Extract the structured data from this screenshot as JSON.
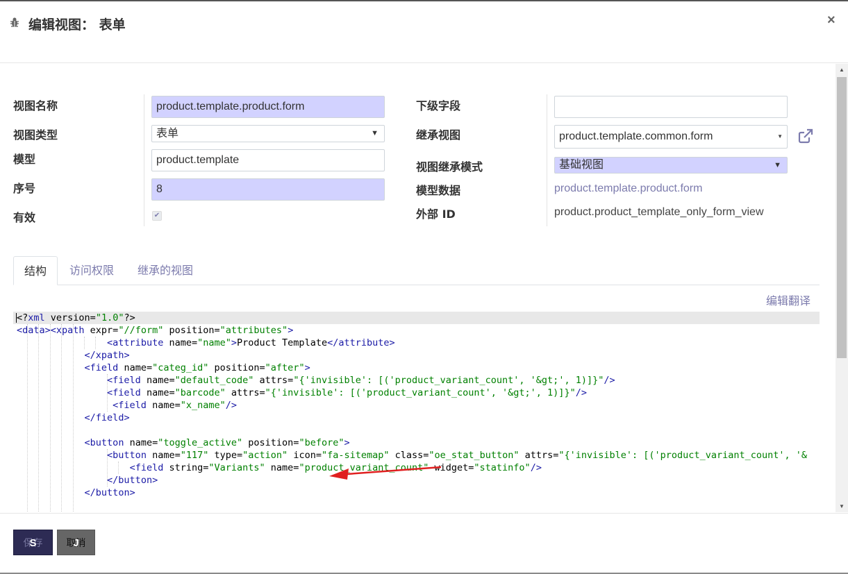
{
  "dialog": {
    "title": "编辑视图： 表单",
    "close_label": "×"
  },
  "form": {
    "view_name_label": "视图名称",
    "view_name_value": "product.template.product.form",
    "view_type_label": "视图类型",
    "view_type_value": "表单",
    "model_label": "模型",
    "model_value": "product.template",
    "sequence_label": "序号",
    "sequence_value": "8",
    "active_label": "有效",
    "active_checked": true,
    "child_field_label": "下级字段",
    "child_field_value": "",
    "inherit_view_label": "继承视图",
    "inherit_view_value": "product.template.common.form",
    "inherit_mode_label": "视图继承模式",
    "inherit_mode_value": "基础视图",
    "model_data_label": "模型数据",
    "model_data_value": "product.template.product.form",
    "external_id_label": "外部 ID",
    "external_id_value": "product.product_template_only_form_view"
  },
  "tabs": [
    {
      "label": "结构",
      "active": true
    },
    {
      "label": "访问权限",
      "active": false
    },
    {
      "label": "继承的视图",
      "active": false
    }
  ],
  "edit_translation_label": "编辑翻译",
  "footer": {
    "save_label": "保存",
    "save_hotkey": "S",
    "cancel_label": "取消",
    "cancel_hotkey": "J"
  },
  "icons": {
    "bug": "bug-icon",
    "external": "external-link-icon",
    "close": "close-icon"
  },
  "colors": {
    "accent": "#7c7bad",
    "required_bg": "#d2d2ff",
    "primary_button": "#2d2b54",
    "arrow": "#e02020"
  }
}
